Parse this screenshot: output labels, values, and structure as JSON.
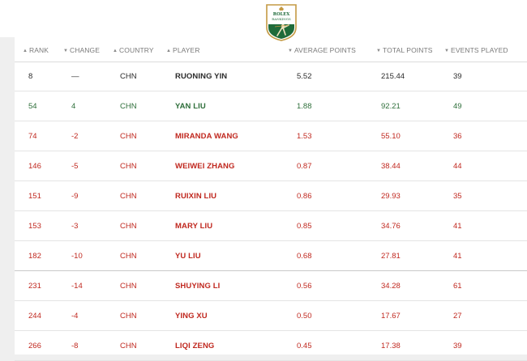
{
  "logo": {
    "line1": "ROLEX",
    "line2": "RANKINGS"
  },
  "colors": {
    "neutral": "#2b2b2b",
    "up": "#2e6e3a",
    "down": "#c0281f",
    "logo_green": "#1f6b3a",
    "logo_gold": "#c49a44"
  },
  "columns": [
    {
      "key": "rank",
      "label": "RANK",
      "icon": "sort-up-arrow-icon"
    },
    {
      "key": "change",
      "label": "CHANGE",
      "icon": "sort-down-arrow-icon"
    },
    {
      "key": "country",
      "label": "COUNTRY",
      "icon": "sort-up-arrow-icon"
    },
    {
      "key": "player",
      "label": "PLAYER",
      "icon": "sort-up-arrow-icon"
    },
    {
      "key": "avg",
      "label": "AVERAGE POINTS",
      "icon": "sort-down-arrow-icon"
    },
    {
      "key": "total",
      "label": "TOTAL POINTS",
      "icon": "sort-down-arrow-icon"
    },
    {
      "key": "events",
      "label": "EVENTS PLAYED",
      "icon": "sort-down-arrow-icon"
    }
  ],
  "rows": [
    {
      "rank": "8",
      "change": "—",
      "country": "CHN",
      "player": "RUONING YIN",
      "avg": "5.52",
      "total": "215.44",
      "events": "39",
      "trend": "neutral"
    },
    {
      "rank": "54",
      "change": "4",
      "country": "CHN",
      "player": "YAN LIU",
      "avg": "1.88",
      "total": "92.21",
      "events": "49",
      "trend": "up"
    },
    {
      "rank": "74",
      "change": "-2",
      "country": "CHN",
      "player": "MIRANDA WANG",
      "avg": "1.53",
      "total": "55.10",
      "events": "36",
      "trend": "down"
    },
    {
      "rank": "146",
      "change": "-5",
      "country": "CHN",
      "player": "WEIWEI ZHANG",
      "avg": "0.87",
      "total": "38.44",
      "events": "44",
      "trend": "down"
    },
    {
      "rank": "151",
      "change": "-9",
      "country": "CHN",
      "player": "RUIXIN LIU",
      "avg": "0.86",
      "total": "29.93",
      "events": "35",
      "trend": "down"
    },
    {
      "rank": "153",
      "change": "-3",
      "country": "CHN",
      "player": "MARY LIU",
      "avg": "0.85",
      "total": "34.76",
      "events": "41",
      "trend": "down"
    },
    {
      "rank": "182",
      "change": "-10",
      "country": "CHN",
      "player": "YU LIU",
      "avg": "0.68",
      "total": "27.81",
      "events": "41",
      "trend": "down"
    },
    {
      "rank": "231",
      "change": "-14",
      "country": "CHN",
      "player": "SHUYING LI",
      "avg": "0.56",
      "total": "34.28",
      "events": "61",
      "trend": "down"
    },
    {
      "rank": "244",
      "change": "-4",
      "country": "CHN",
      "player": "YING XU",
      "avg": "0.50",
      "total": "17.67",
      "events": "27",
      "trend": "down"
    },
    {
      "rank": "266",
      "change": "-8",
      "country": "CHN",
      "player": "LIQI ZENG",
      "avg": "0.45",
      "total": "17.38",
      "events": "39",
      "trend": "down"
    }
  ]
}
